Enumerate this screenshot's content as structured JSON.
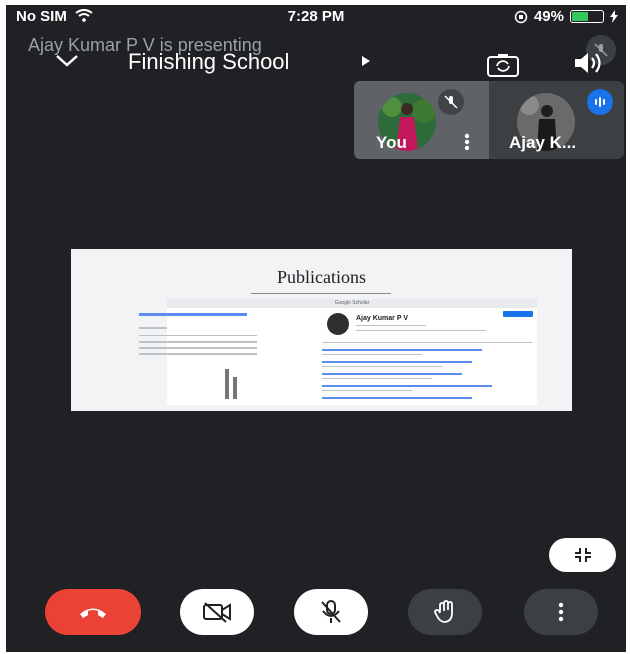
{
  "status_bar": {
    "carrier": "No SIM",
    "time": "7:28 PM",
    "battery": "49%"
  },
  "header": {
    "presenting": "Ajay Kumar P V is presenting",
    "meeting_title": "Finishing School"
  },
  "participants": [
    {
      "name": "You",
      "muted": true
    },
    {
      "name": "Ajay K...",
      "speaking": true
    }
  ],
  "slide": {
    "title": "Publications",
    "scholar_header": "Google Scholar",
    "profile_name": "Ajay Kumar P V"
  },
  "colors": {
    "end_call": "#ea4335",
    "speaking_badge": "#1a73e8",
    "background": "#202124"
  },
  "controls": {
    "end_call": "phone-hangup-icon",
    "camera": "camera-off-icon",
    "mic": "mic-off-icon",
    "raise_hand": "hand-icon",
    "more": "more-vert-icon",
    "shrink": "shrink-icon"
  }
}
